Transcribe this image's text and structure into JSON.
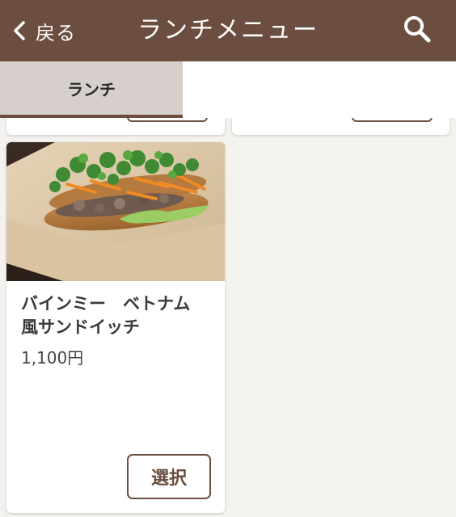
{
  "header": {
    "back_label": "戻る",
    "title": "ランチメニュー",
    "back_icon": "chevron-left-icon",
    "search_icon": "search-icon"
  },
  "tabs": [
    {
      "label": "ランチ",
      "active": true
    }
  ],
  "items": [
    {
      "name": "バインミー　ベトナム\n風サンドイッチ",
      "price": "1,100円",
      "select_label": "選択"
    }
  ],
  "colors": {
    "brand": "#6b4e3f",
    "tab_active_bg": "#d6cfcb",
    "page_bg": "#f3f2ee"
  }
}
